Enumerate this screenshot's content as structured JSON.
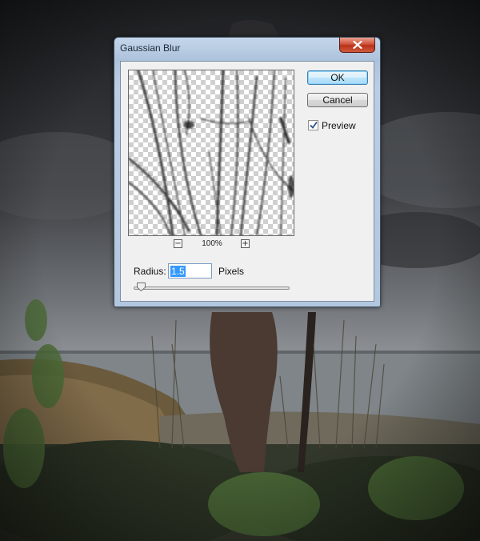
{
  "window": {
    "title": "Gaussian Blur",
    "close_icon": "close-icon"
  },
  "preview": {
    "zoom_out_label": "−",
    "zoom_level": "100%",
    "zoom_in_label": "+"
  },
  "buttons": {
    "ok_label": "OK",
    "cancel_label": "Cancel"
  },
  "options": {
    "preview_label": "Preview",
    "preview_checked": true
  },
  "radius": {
    "label": "Radius:",
    "value": "1.5",
    "units": "Pixels",
    "slider_fraction": 0.05
  },
  "colors": {
    "accent": "#3399ff",
    "close_red": "#c8442a",
    "title_bar": "#b8cde4"
  }
}
